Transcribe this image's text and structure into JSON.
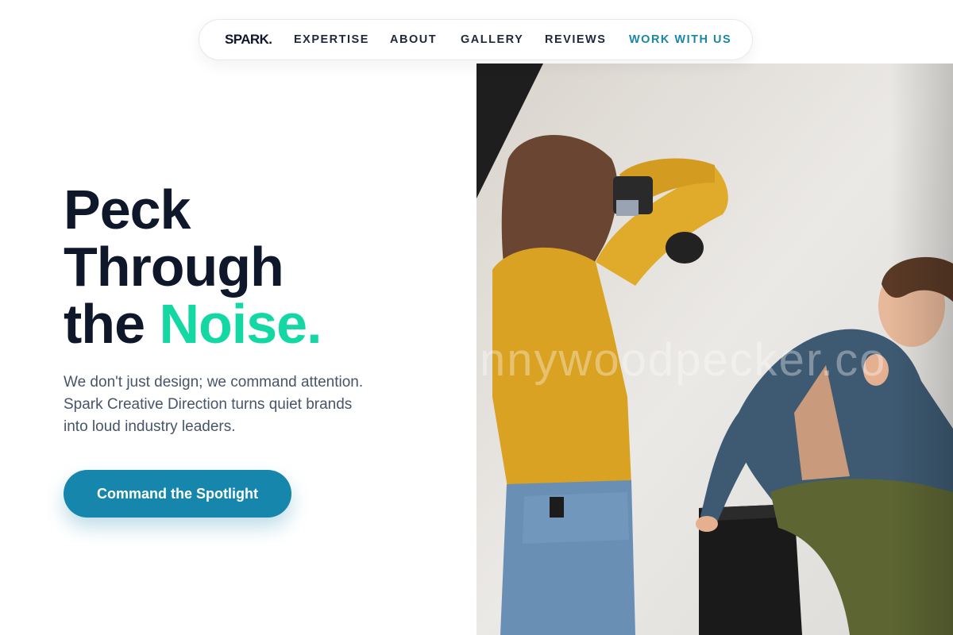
{
  "nav": {
    "logo": "SPARK.",
    "links": [
      "EXPERTISE",
      "ABOUT",
      "GALLERY",
      "REVIEWS"
    ],
    "cta": "WORK WITH US"
  },
  "hero": {
    "headline_line1": "Peck",
    "headline_line2": "Through",
    "headline_line3_plain": "the ",
    "headline_line3_accent": "Noise",
    "headline_line3_dot": ".",
    "lead_line1": "We don't just design; we command attention.",
    "lead_line2": "Spark Creative Direction turns quiet brands",
    "lead_line3": "into loud industry leaders.",
    "cta_label": "Command the Spotlight"
  },
  "image": {
    "watermark": "nnywoodpecker.co"
  },
  "colors": {
    "heading": "#0f172a",
    "accent_green": "#14d8a3",
    "accent_blue": "#1686ad",
    "body_text": "#475569"
  }
}
